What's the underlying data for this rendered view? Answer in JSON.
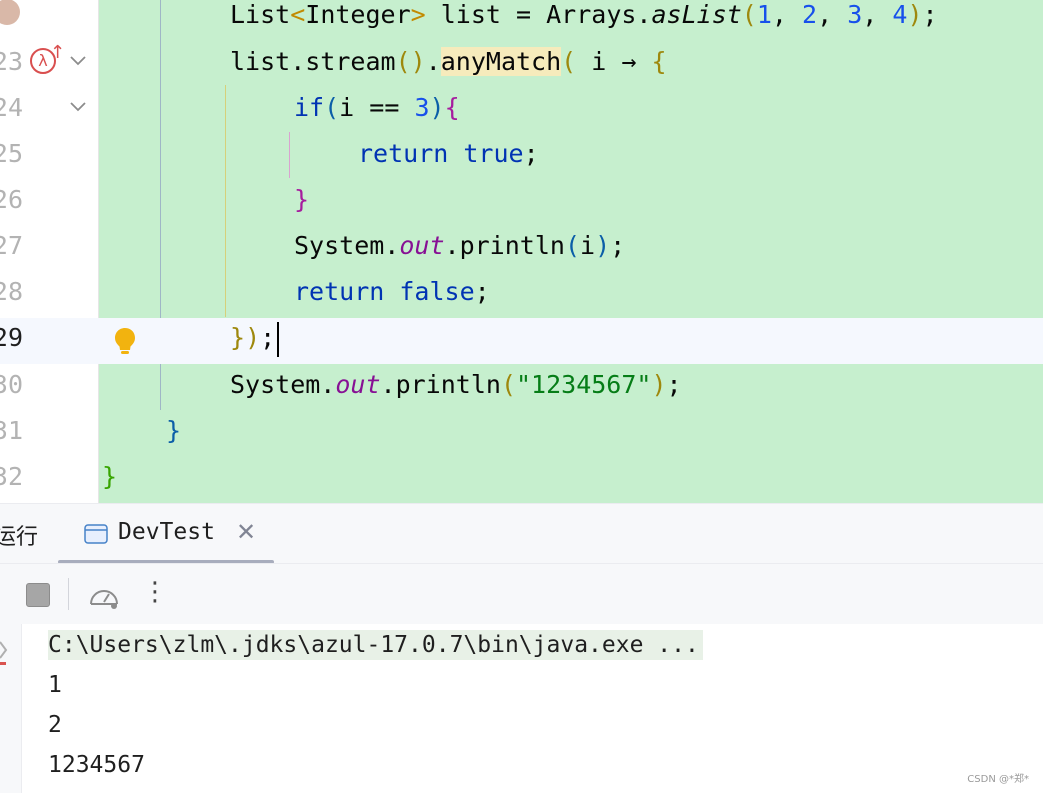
{
  "editor": {
    "lines": [
      {
        "num": "",
        "id": "line-22"
      },
      {
        "num": "23",
        "id": "line-23"
      },
      {
        "num": "24",
        "id": "line-24"
      },
      {
        "num": "25",
        "id": "line-25"
      },
      {
        "num": "26",
        "id": "line-26"
      },
      {
        "num": "27",
        "id": "line-27"
      },
      {
        "num": "28",
        "id": "line-28"
      },
      {
        "num": "29",
        "id": "line-29"
      },
      {
        "num": "30",
        "id": "line-30"
      },
      {
        "num": "31",
        "id": "line-31"
      },
      {
        "num": "32",
        "id": "line-32"
      }
    ],
    "tokens": {
      "l22": {
        "a": "List",
        "b": "<",
        "c": "Integer",
        "d": ">",
        "e": " list = Arrays.",
        "f": "asList",
        "g": "(",
        "h": "1",
        "i": ", ",
        "j": "2",
        "k": ", ",
        "l": "3",
        "m": ", ",
        "n": "4",
        "o": ")",
        "p": ";"
      },
      "l23": {
        "a": "list.stream",
        "b": "()",
        "c": ".",
        "d": "anyMatch",
        "e": "(",
        "f": " i ",
        "g": "→",
        "h": " ",
        "i": "{"
      },
      "l24": {
        "a": "if",
        "b": "(",
        "c": "i ",
        "d": "==",
        "e": " ",
        "f": "3",
        "g": ")",
        "h": "{"
      },
      "l25": {
        "a": "return",
        "b": " ",
        "c": "true",
        "d": ";"
      },
      "l26": {
        "a": "}"
      },
      "l27": {
        "a": "System.",
        "b": "out",
        "c": ".println",
        "d": "(",
        "e": "i",
        "f": ")",
        "g": ";"
      },
      "l28": {
        "a": "return",
        "b": " ",
        "c": "false",
        "d": ";"
      },
      "l29": {
        "a": "}",
        "b": ")",
        "c": ";"
      },
      "l30": {
        "a": "System.",
        "b": "out",
        "c": ".println",
        "d": "(",
        "e": "\"1234567\"",
        "f": ")",
        "g": ";"
      },
      "l31": {
        "a": "}"
      },
      "l32": {
        "a": "}"
      }
    },
    "gutter_icons": {
      "lambda_label": "λ",
      "arrow_label": "↑"
    },
    "colors": {
      "background": "#c6efce",
      "current_line": "#f5f8fe",
      "keyword": "#0033b3",
      "number": "#1750eb",
      "string": "#067d17",
      "static_field": "#871094"
    }
  },
  "tool_window": {
    "run_label": "运行",
    "tab_label": "DevTest",
    "close_glyph": "✕",
    "more_glyph": "⋮"
  },
  "console": {
    "lines": [
      "C:\\Users\\zlm\\.jdks\\azul-17.0.7\\bin\\java.exe ...",
      "1",
      "2",
      "1234567"
    ]
  },
  "watermark": "CSDN @*郑*"
}
